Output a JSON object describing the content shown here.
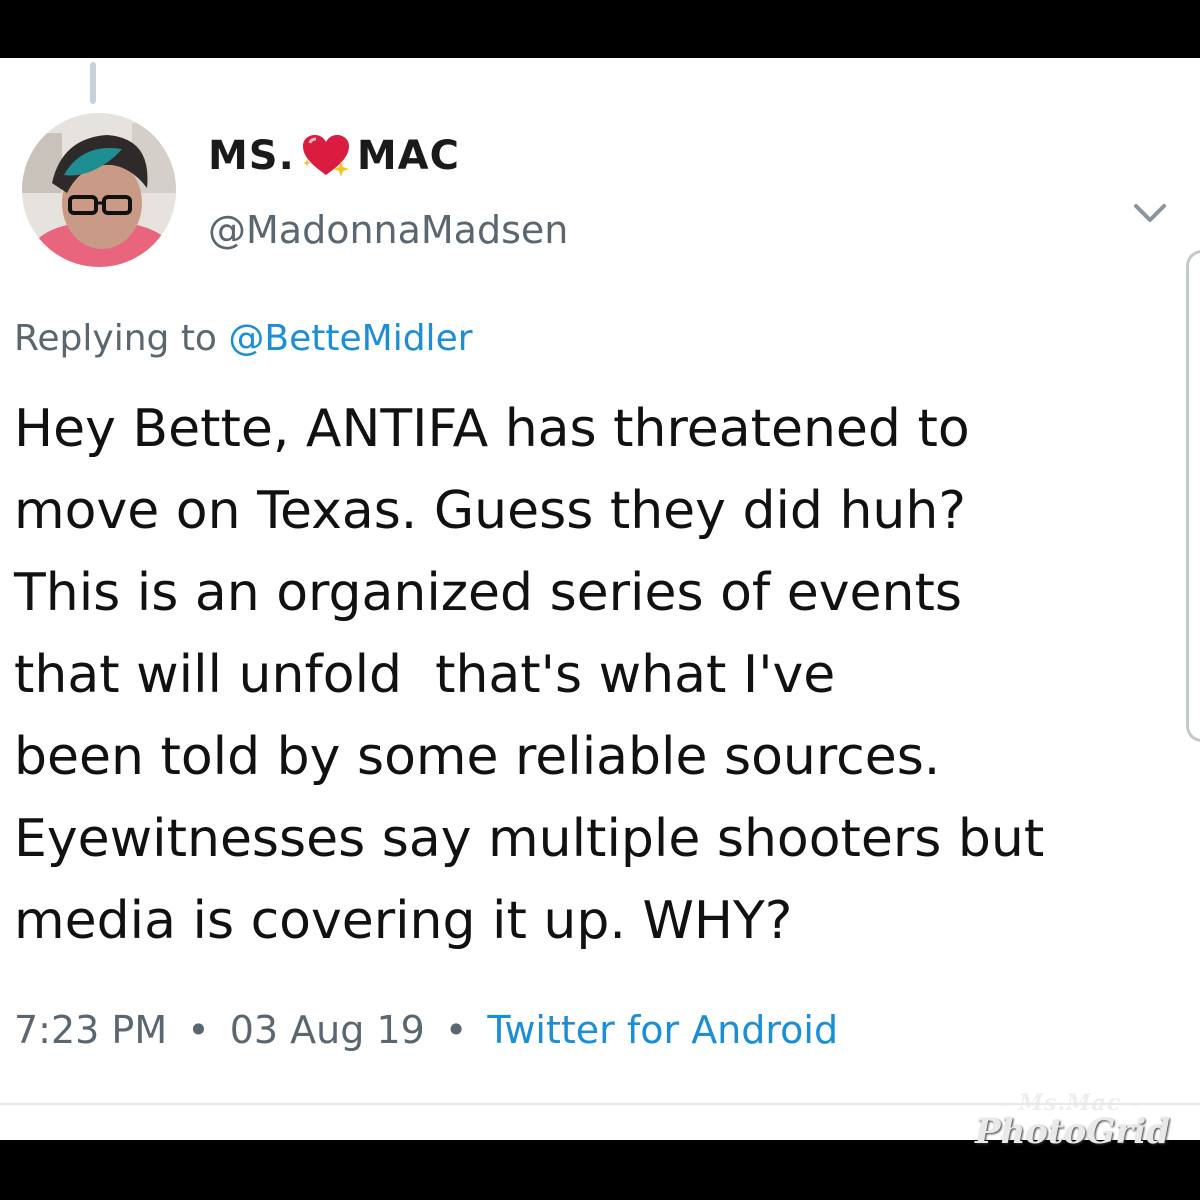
{
  "profile": {
    "display_name_prefix": "MS.",
    "display_name_suffix": "MAC",
    "heart_icon": "sparkling-heart-icon",
    "handle": "@MadonnaMadsen"
  },
  "reply": {
    "prefix": "Replying to",
    "target": "@BetteMidler"
  },
  "tweet": {
    "lines": [
      "Hey Bette, ANTIFA has threatened to",
      "move on Texas. Guess they did huh?",
      "This is an organized series of events",
      "that will unfold  that's what I've",
      "been told by some reliable sources.",
      "Eyewitnesses say multiple shooters but",
      "media is covering it up. WHY?"
    ]
  },
  "meta": {
    "time": "7:23 PM",
    "date": "03 Aug 19",
    "separator": "•",
    "source": "Twitter for Android"
  },
  "watermark": {
    "top": "– Ms.Mac –",
    "bottom": "PhotoGrid"
  },
  "colors": {
    "link": "#1b8fd6",
    "muted": "#5b6770",
    "text": "#111111",
    "heart": "#d91c3f"
  }
}
